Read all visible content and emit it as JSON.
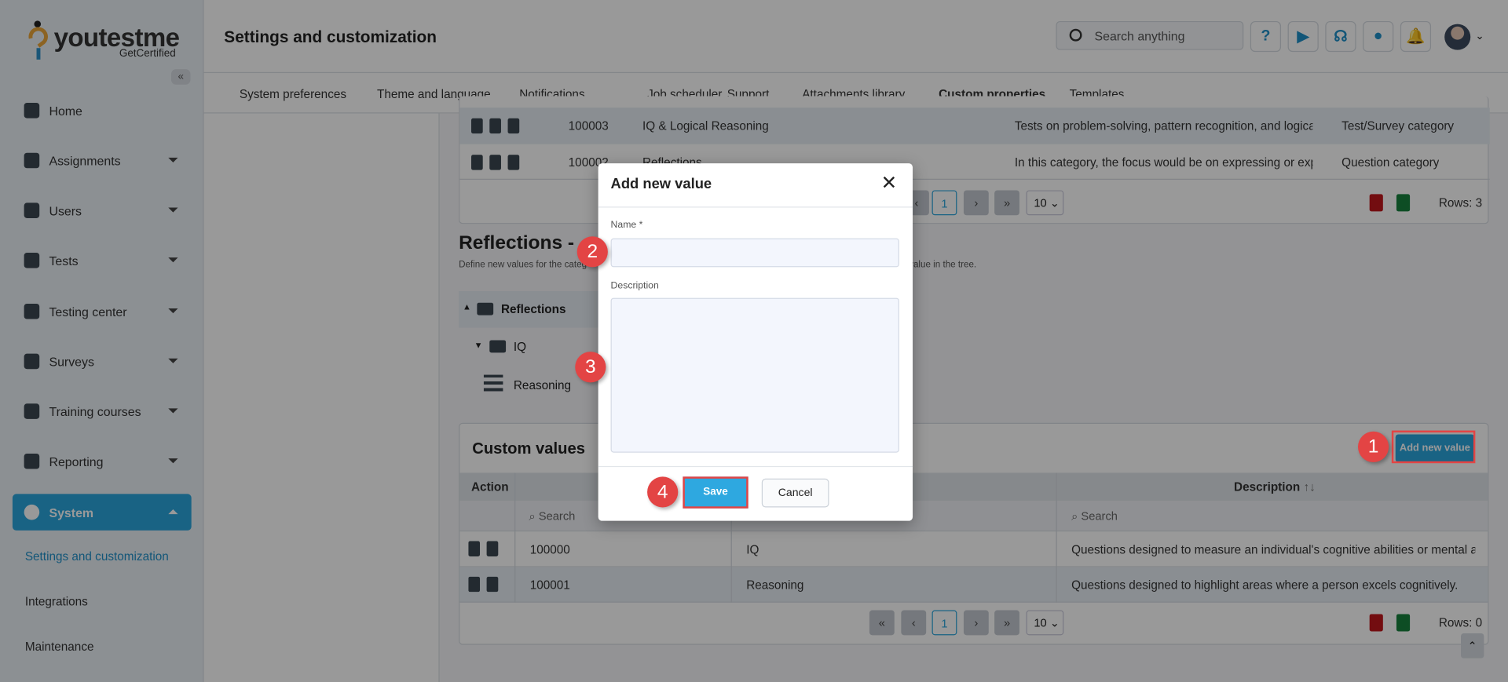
{
  "brand": {
    "name": "youtestme",
    "tagline": "GetCertified"
  },
  "sidebar": {
    "items": [
      {
        "label": "Home",
        "icon": "home-icon"
      },
      {
        "label": "Assignments",
        "icon": "assignments-icon"
      },
      {
        "label": "Users",
        "icon": "users-icon"
      },
      {
        "label": "Tests",
        "icon": "tests-icon"
      },
      {
        "label": "Testing center",
        "icon": "testing-center-icon"
      },
      {
        "label": "Surveys",
        "icon": "surveys-icon"
      },
      {
        "label": "Training courses",
        "icon": "trophy-icon"
      },
      {
        "label": "Reporting",
        "icon": "reporting-icon"
      },
      {
        "label": "System",
        "icon": "gear-icon",
        "active": true
      }
    ],
    "subitems": [
      {
        "label": "Settings and customization",
        "active": true
      },
      {
        "label": "Integrations"
      },
      {
        "label": "Maintenance"
      }
    ]
  },
  "header": {
    "title": "Settings and customization",
    "search_placeholder": "Search anything"
  },
  "tabs": [
    "System preferences",
    "Theme and language",
    "Notifications",
    "Job scheduler",
    "Support",
    "Attachments library",
    "Custom properties",
    "Templates"
  ],
  "active_tab": "Custom properties",
  "top_table": {
    "rows": [
      {
        "id": "100003",
        "name": "IQ & Logical Reasoning",
        "description": "Tests on problem-solving, pattern recognition, and logical...",
        "type": "Test/Survey category"
      },
      {
        "id": "100002",
        "name": "Reflections",
        "description": "In this category, the focus would be on expressing or expl...",
        "type": "Question category"
      }
    ],
    "page": "1",
    "page_size": "10",
    "rows_label": "Rows: 3"
  },
  "section": {
    "title": "Reflections - ",
    "subtitle_start": "Define new values for the categ",
    "subtitle_end": "value in the tree."
  },
  "tree": {
    "root": "Reflections",
    "child": "IQ",
    "leaf": "Reasoning"
  },
  "custom_values": {
    "title": "Custom values",
    "add_button": "Add new value",
    "headers": {
      "action": "Action",
      "description": "Description",
      "sort": "↑↓"
    },
    "search_placeholder": "Search",
    "rows": [
      {
        "id": "100000",
        "name": "IQ",
        "description": "Questions designed to measure an individual's cognitive abilities or mental apti..."
      },
      {
        "id": "100001",
        "name": "Reasoning",
        "description": "Questions designed to highlight areas where a person excels cognitively."
      }
    ],
    "page": "1",
    "page_size": "10",
    "rows_label": "Rows: 0"
  },
  "dialog": {
    "title": "Add new value",
    "name_label": "Name *",
    "name_value": "",
    "description_label": "Description",
    "description_value": "",
    "save": "Save",
    "cancel": "Cancel"
  },
  "annotations": [
    "1",
    "2",
    "3",
    "4"
  ],
  "colors": {
    "accent": "#2aa5dc",
    "annotation": "#e34444"
  }
}
